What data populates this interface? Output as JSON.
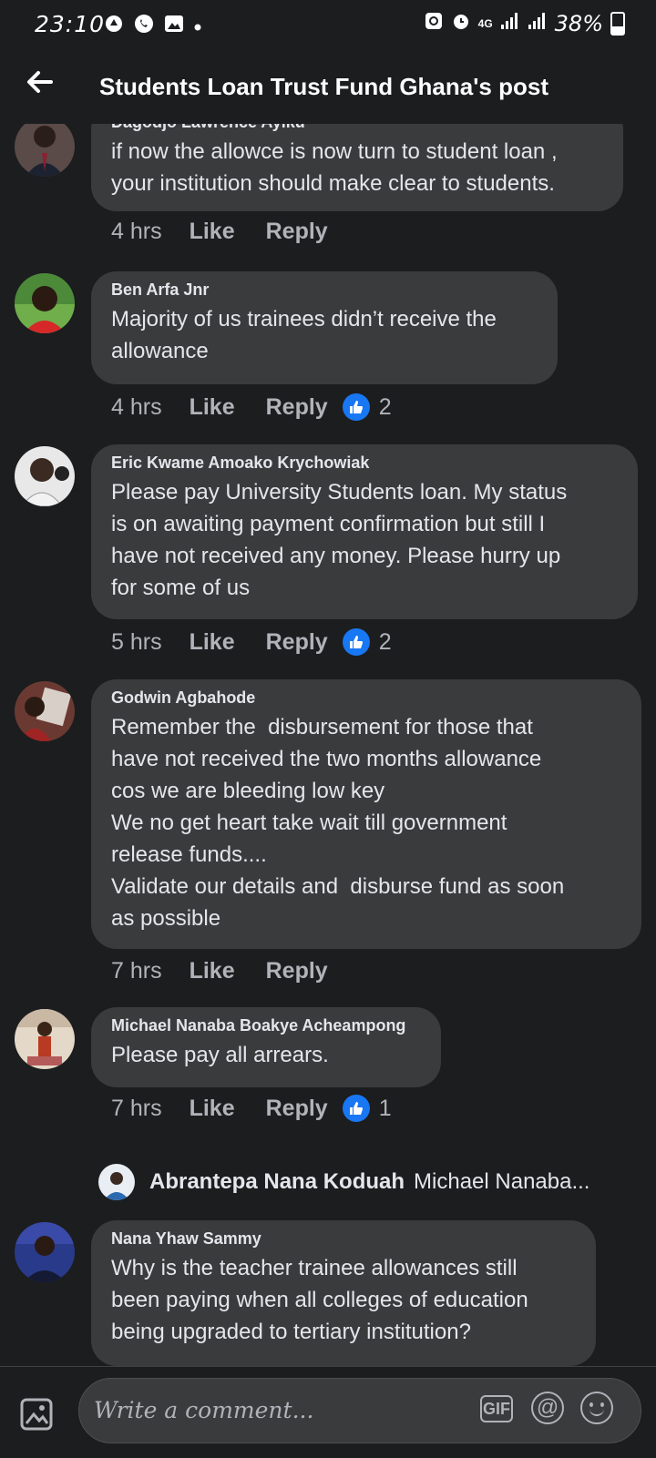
{
  "status_bar": {
    "time": "23:10",
    "network": "4G",
    "battery": "38%"
  },
  "header": {
    "title": "Students Loan Trust Fund Ghana's post"
  },
  "comments": [
    {
      "author": "Dagodjo Lawrence Ayiku",
      "text": "if now the allowce is now turn to student loan ,\nyour institution should make clear to students.",
      "time": "4 hrs",
      "like_label": "Like",
      "reply_label": "Reply",
      "reactions": null
    },
    {
      "author": "Ben Arfa Jnr",
      "text": "Majority of us trainees didn’t receive the\nallowance",
      "time": "4 hrs",
      "like_label": "Like",
      "reply_label": "Reply",
      "reactions": "2"
    },
    {
      "author": "Eric Kwame Amoako Krychowiak",
      "text": "Please pay University Students loan. My status\nis on awaiting payment confirmation but still I\nhave not received any money. Please hurry up\nfor some of us",
      "time": "5 hrs",
      "like_label": "Like",
      "reply_label": "Reply",
      "reactions": "2"
    },
    {
      "author": "Godwin Agbahode",
      "text": "Remember the  disbursement for those that\nhave not received the two months allowance\ncos we are bleeding low key\nWe no get heart take wait till government\nrelease funds....\nValidate our details and  disburse fund as soon\nas possible",
      "time": "7 hrs",
      "like_label": "Like",
      "reply_label": "Reply",
      "reactions": null
    },
    {
      "author": "Michael Nanaba Boakye Acheampong",
      "text": "Please pay all arrears.",
      "time": "7 hrs",
      "like_label": "Like",
      "reply_label": "Reply",
      "reactions": "1"
    },
    {
      "author": "Nana Yhaw Sammy",
      "text": "Why is the teacher trainee allowances still\nbeen paying when all colleges of education\nbeing upgraded to tertiary institution?",
      "time": null,
      "like_label": null,
      "reply_label": null,
      "reactions": null
    }
  ],
  "reply_preview": {
    "author": "Abrantepa Nana Koduah",
    "text": "Michael Nanaba..."
  },
  "composer": {
    "placeholder": "Write a comment...",
    "gif_label": "GIF",
    "mention_label": "@"
  },
  "colors": {
    "background": "#1c1d1f",
    "bubble": "#3a3b3c",
    "text_primary": "#e4e6eb",
    "text_secondary": "#b0b3b8",
    "like_blue": "#1877f2"
  }
}
